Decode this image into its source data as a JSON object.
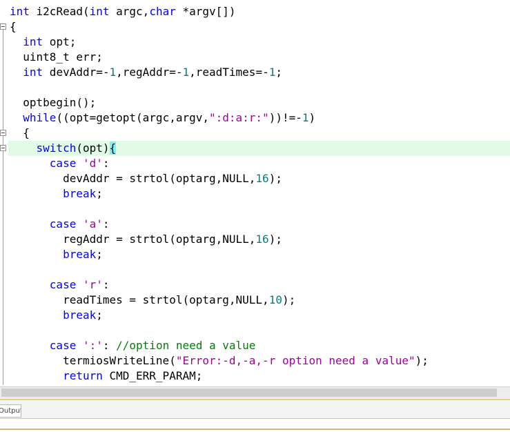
{
  "editor": {
    "lines": [
      [
        {
          "t": "int",
          "c": "kw"
        },
        {
          "t": " i2cRead("
        },
        {
          "t": "int",
          "c": "kw"
        },
        {
          "t": " argc,"
        },
        {
          "t": "char",
          "c": "kw"
        },
        {
          "t": " *argv[])"
        }
      ],
      [
        {
          "t": "{"
        }
      ],
      [
        {
          "t": "  "
        },
        {
          "t": "int",
          "c": "kw"
        },
        {
          "t": " opt;"
        }
      ],
      [
        {
          "t": "  uint8_t err;"
        }
      ],
      [
        {
          "t": "  "
        },
        {
          "t": "int",
          "c": "kw"
        },
        {
          "t": " devAddr=-"
        },
        {
          "t": "1",
          "c": "num"
        },
        {
          "t": ",regAddr=-"
        },
        {
          "t": "1",
          "c": "num"
        },
        {
          "t": ",readTimes=-"
        },
        {
          "t": "1",
          "c": "num"
        },
        {
          "t": ";"
        }
      ],
      [],
      [
        {
          "t": "  optbegin();"
        }
      ],
      [
        {
          "t": "  "
        },
        {
          "t": "while",
          "c": "kw"
        },
        {
          "t": "((opt=getopt(argc,argv,"
        },
        {
          "t": "\":d:a:r:\"",
          "c": "str"
        },
        {
          "t": "))!=-"
        },
        {
          "t": "1",
          "c": "num"
        },
        {
          "t": ")"
        }
      ],
      [
        {
          "t": "  {"
        }
      ],
      [
        {
          "t": "    "
        },
        {
          "t": "switch",
          "c": "kw"
        },
        {
          "t": "(opt)"
        },
        {
          "t": "{",
          "c": "brace-hl"
        }
      ],
      [
        {
          "t": "      "
        },
        {
          "t": "case",
          "c": "kw"
        },
        {
          "t": " "
        },
        {
          "t": "'d'",
          "c": "str"
        },
        {
          "t": ":"
        }
      ],
      [
        {
          "t": "        devAddr = strtol(optarg,NULL,"
        },
        {
          "t": "16",
          "c": "num"
        },
        {
          "t": ");"
        }
      ],
      [
        {
          "t": "        "
        },
        {
          "t": "break",
          "c": "kw"
        },
        {
          "t": ";"
        }
      ],
      [],
      [
        {
          "t": "      "
        },
        {
          "t": "case",
          "c": "kw"
        },
        {
          "t": " "
        },
        {
          "t": "'a'",
          "c": "str"
        },
        {
          "t": ":"
        }
      ],
      [
        {
          "t": "        regAddr = strtol(optarg,NULL,"
        },
        {
          "t": "16",
          "c": "num"
        },
        {
          "t": ");"
        }
      ],
      [
        {
          "t": "        "
        },
        {
          "t": "break",
          "c": "kw"
        },
        {
          "t": ";"
        }
      ],
      [],
      [
        {
          "t": "      "
        },
        {
          "t": "case",
          "c": "kw"
        },
        {
          "t": " "
        },
        {
          "t": "'r'",
          "c": "str"
        },
        {
          "t": ":"
        }
      ],
      [
        {
          "t": "        readTimes = strtol(optarg,NULL,"
        },
        {
          "t": "10",
          "c": "num"
        },
        {
          "t": ");"
        }
      ],
      [
        {
          "t": "        "
        },
        {
          "t": "break",
          "c": "kw"
        },
        {
          "t": ";"
        }
      ],
      [],
      [
        {
          "t": "      "
        },
        {
          "t": "case",
          "c": "kw"
        },
        {
          "t": " "
        },
        {
          "t": "':'",
          "c": "str"
        },
        {
          "t": ": "
        },
        {
          "t": "//option need a value",
          "c": "cmt"
        }
      ],
      [
        {
          "t": "        termiosWriteLine("
        },
        {
          "t": "\"Error:-d,-a,-r option need a value\"",
          "c": "str"
        },
        {
          "t": ");"
        }
      ],
      [
        {
          "t": "        "
        },
        {
          "t": "return",
          "c": "kw"
        },
        {
          "t": " CMD_ERR_PARAM;"
        }
      ]
    ]
  },
  "output_panel": {
    "tab_label": "Output"
  },
  "colors": {
    "keyword": "#0000ff",
    "number": "#008080",
    "string": "#a000a0",
    "comment": "#008000",
    "current_line": "#e0fbe6",
    "brace_match": "#7ff0f8"
  }
}
